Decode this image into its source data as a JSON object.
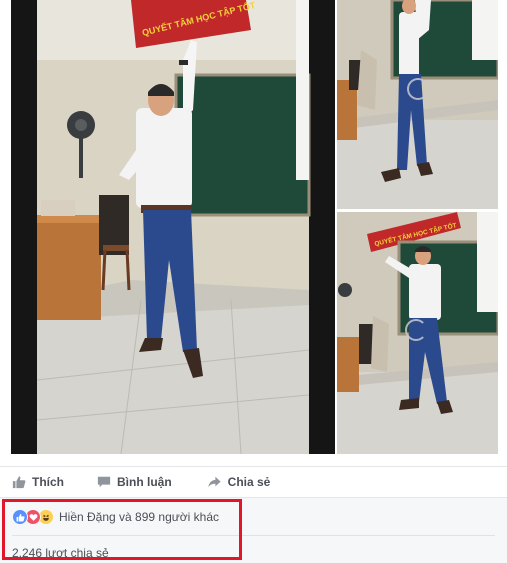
{
  "post": {
    "actions": {
      "like_label": "Thích",
      "comment_label": "Bình luận",
      "share_label": "Chia sẻ"
    },
    "reactions": {
      "icons": [
        "like-icon",
        "love-icon",
        "haha-icon"
      ],
      "summary_text": "Hiền Đặng và 899 người khác"
    },
    "share_count_text": "2.246 lượt chia sẻ",
    "photos": [
      {
        "id": "main",
        "banner_text": "QUYẾT TÂM HỌC TẬP TỐT"
      },
      {
        "id": "top-right"
      },
      {
        "id": "bottom-right",
        "banner_text": "QUYẾT TÂM HỌC TẬP TỐT"
      }
    ]
  },
  "colors": {
    "text": "#4b4f56",
    "summary_bg": "#f6f7f9",
    "like_blue": "#5890ff",
    "love_red": "#f25268",
    "haha_yellow": "#fcd052",
    "highlight_red": "#e0162b",
    "banner_red": "#c0282a",
    "banner_yellow": "#f2d23a",
    "chalkboard": "#1f4a3a"
  }
}
